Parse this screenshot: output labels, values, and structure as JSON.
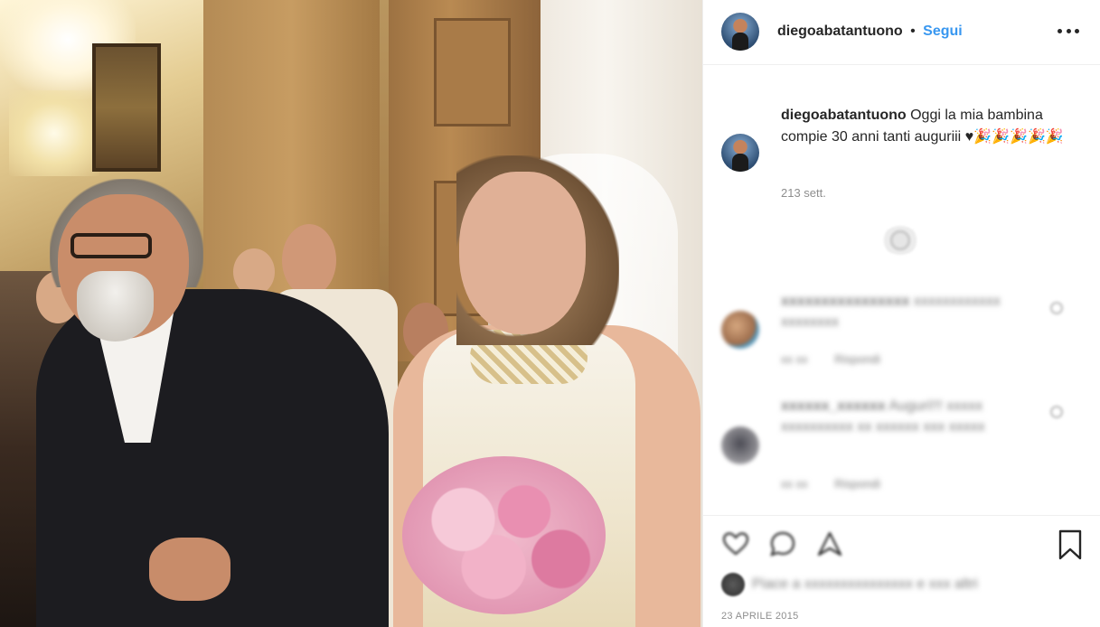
{
  "header": {
    "username": "diegoabatantuono",
    "separator": "•",
    "follow_label": "Segui",
    "more_icon": "more-options-icon"
  },
  "post": {
    "photo_description_icon": "post-photo",
    "caption_username": "diegoabatantuono",
    "caption_text": "Oggi la mia bambina compie 30 anni tanti auguriii ♥🎉🎉🎉🎉🎉",
    "time_ago": "213 sett.",
    "date": "23 APRILE 2015"
  },
  "comments": [
    {
      "username": "xxxxxxxxxxxxxxxx",
      "text": "xxxxxxxxxxxx xxxxxxxx",
      "time": "xx xx",
      "reply_label": "Rispondi"
    },
    {
      "username": "xxxxxx_xxxxxx",
      "text": "Auguri!!! xxxxx xxxxxxxxxx xx xxxxxx xxx xxxxx",
      "time": "xx xx",
      "reply_label": "Rispondi"
    }
  ],
  "likes": {
    "text": "Piace a xxxxxxxxxxxxxxx e xxx altri"
  },
  "icons": {
    "like": "heart-outline-icon",
    "comment": "comment-bubble-icon",
    "share": "share-icon",
    "save": "bookmark-icon",
    "load_more": "load-more-icon"
  },
  "colors": {
    "accent": "#3897f0",
    "text": "#262626",
    "muted": "#8e8e8e",
    "border": "#efefef"
  }
}
